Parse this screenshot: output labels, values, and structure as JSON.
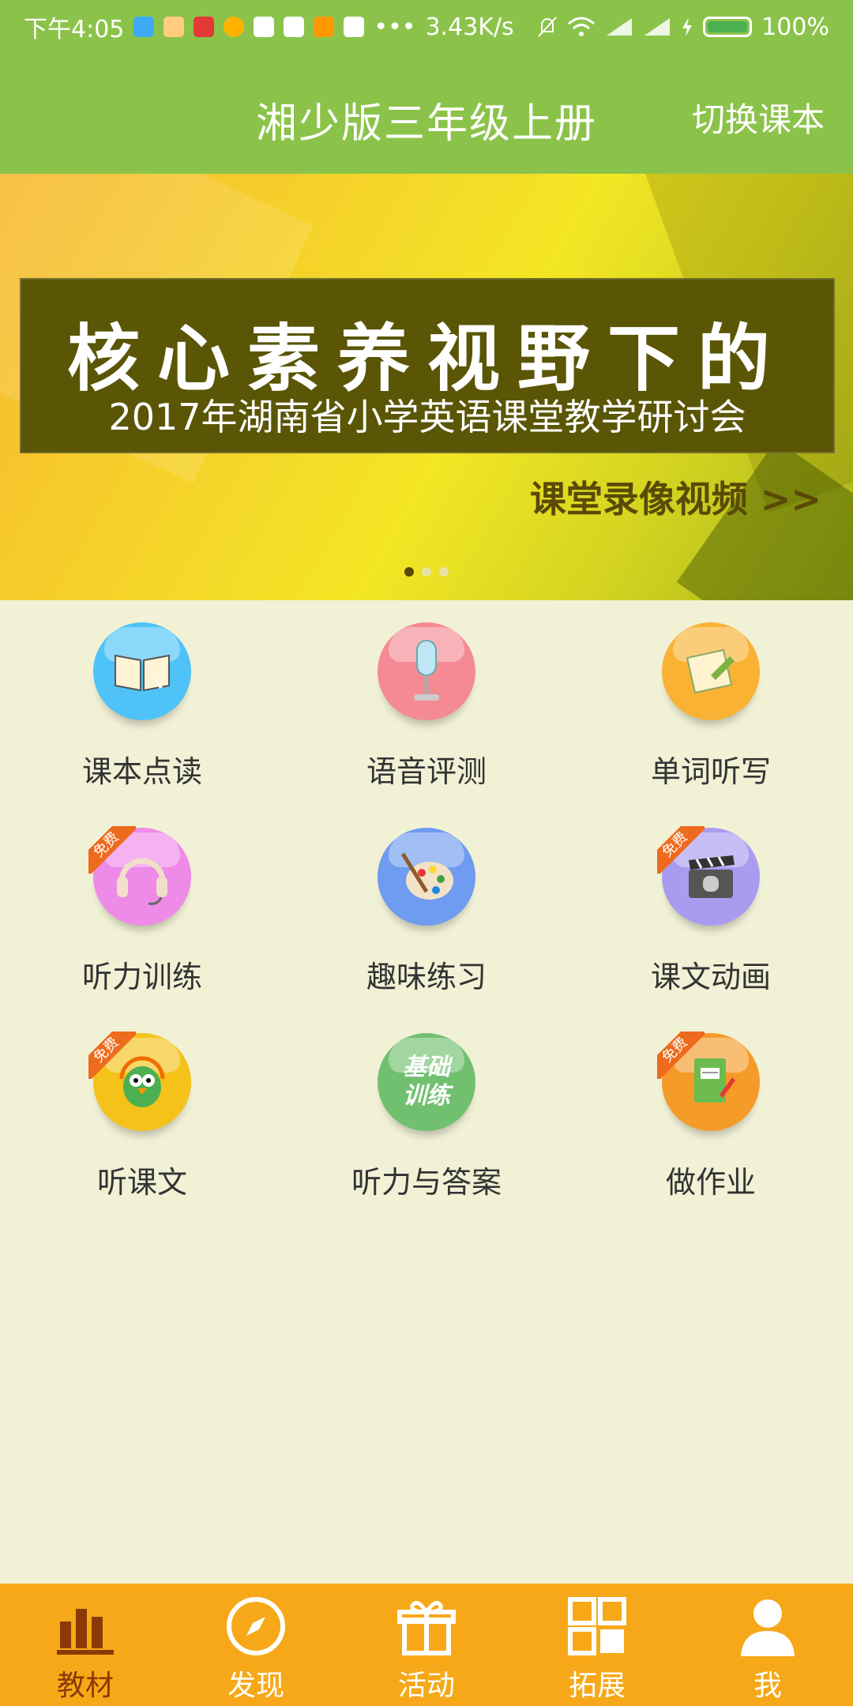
{
  "status_bar": {
    "time": "下午4:05",
    "network_speed": "3.43K/s",
    "battery": "100%",
    "colors": {
      "background": "#8bc34a"
    }
  },
  "header": {
    "title": "湘少版三年级上册",
    "switch_label": "切换课本"
  },
  "banner": {
    "headline": "核心素养视野下的",
    "subtitle": "2017年湖南省小学英语课堂教学研讨会",
    "link": "课堂录像视频 >>",
    "dots": [
      true,
      false,
      false
    ]
  },
  "tiles": [
    {
      "label": "课本点读",
      "icon": "open-book-icon",
      "color": "#4fc3f7",
      "free": false
    },
    {
      "label": "语音评测",
      "icon": "microphone-icon",
      "color": "#f48a94",
      "free": false
    },
    {
      "label": "单词听写",
      "icon": "paper-pencil-icon",
      "color": "#f9b233",
      "free": false
    },
    {
      "label": "听力训练",
      "icon": "headphones-icon",
      "color": "#ee8ae8",
      "free": true
    },
    {
      "label": "趣味练习",
      "icon": "palette-icon",
      "color": "#6f9bf0",
      "free": false
    },
    {
      "label": "课文动画",
      "icon": "film-clapper-icon",
      "color": "#a99cf0",
      "free": true
    },
    {
      "label": "听课文",
      "icon": "parrot-headphones-icon",
      "color": "#f5c21a",
      "free": true
    },
    {
      "label": "听力与答案",
      "icon": "basic-training-icon",
      "color": "#71c06f",
      "free": false
    },
    {
      "label": "做作业",
      "icon": "notebook-pen-icon",
      "color": "#f59b28",
      "free": true
    }
  ],
  "free_tag": "免费",
  "basic_training_text": "基础训练",
  "bottom_nav": [
    {
      "label": "教材",
      "icon": "bar-chart-icon",
      "active": true
    },
    {
      "label": "发现",
      "icon": "compass-icon",
      "active": false
    },
    {
      "label": "活动",
      "icon": "gift-icon",
      "active": false
    },
    {
      "label": "拓展",
      "icon": "grid-icon",
      "active": false
    },
    {
      "label": "我",
      "icon": "person-icon",
      "active": false
    }
  ]
}
